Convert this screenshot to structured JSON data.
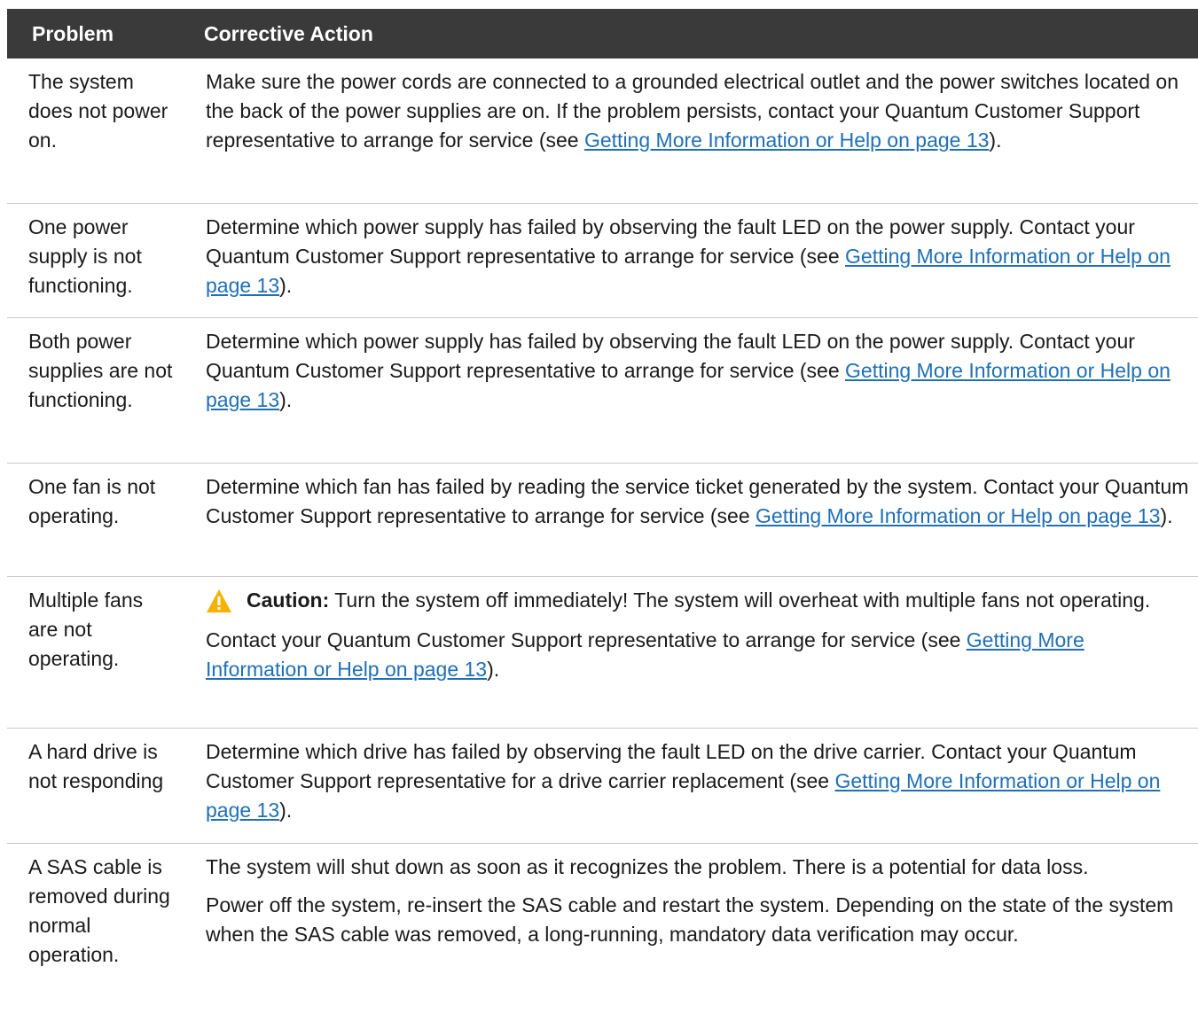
{
  "header": {
    "problem": "Problem",
    "action": "Corrective Action"
  },
  "rows": [
    {
      "problem": "The system does not power on.",
      "action_text": "Make sure the power cords are connected to a grounded electrical outlet and the power switches located on the back of the power supplies are on. If the problem persists, contact your Quantum Customer Support representative to arrange for service (see ",
      "link": "Getting More Information or Help on page 13",
      "after": ")."
    },
    {
      "problem": "One power supply is not functioning.",
      "action_text": "Determine which power supply has failed by observing the fault LED on the power supply. Contact your Quantum Customer Support representative to arrange for service (see ",
      "link": "Getting More Information or Help on page 13",
      "after": ")."
    },
    {
      "problem": "Both power supplies are not functioning.",
      "action_text": "Determine which power supply has failed by observing the fault LED on the power supply. Contact your Quantum Customer Support representative to arrange for service (see ",
      "link": "Getting More Information or Help on page 13",
      "after": ")."
    },
    {
      "problem": "One fan is not operating.",
      "action_text": "Determine which fan has failed by reading the service ticket generated by the system. Contact your Quantum Customer Support representative to arrange for service (see ",
      "link": "Getting More Information or Help on page 13",
      "after": ")."
    },
    {
      "problem": "Multiple fans are not operating.",
      "caution_label": "Caution:",
      "caution_text": " Turn the system off immediately! The system will overheat with multiple fans not operating.",
      "action_text": "Contact your Quantum Customer Support representative to arrange for service (see ",
      "link": "Getting More Information or Help on page 13",
      "after": ")."
    },
    {
      "problem": "A hard drive is not responding",
      "action_text": "Determine which drive has failed by observing the fault LED on the drive carrier. Contact your Quantum Customer Support representative for a drive carrier replacement (see ",
      "link": "Getting More Information or Help on page 13",
      "after": ")."
    },
    {
      "problem": "A SAS cable is removed during normal operation.",
      "para1": "The system will shut down as soon as it recognizes the problem. There is a potential for data loss.",
      "para2": "Power off the system, re-insert the SAS cable and restart the system. Depending on the state of the system when the SAS cable was removed, a long-running, mandatory data verification may occur."
    }
  ],
  "colors": {
    "header_bg": "#3a3a3a",
    "link": "#1f6fb7",
    "caution_icon": "#f5b300"
  },
  "icons": {
    "caution": "warning-triangle-icon"
  }
}
